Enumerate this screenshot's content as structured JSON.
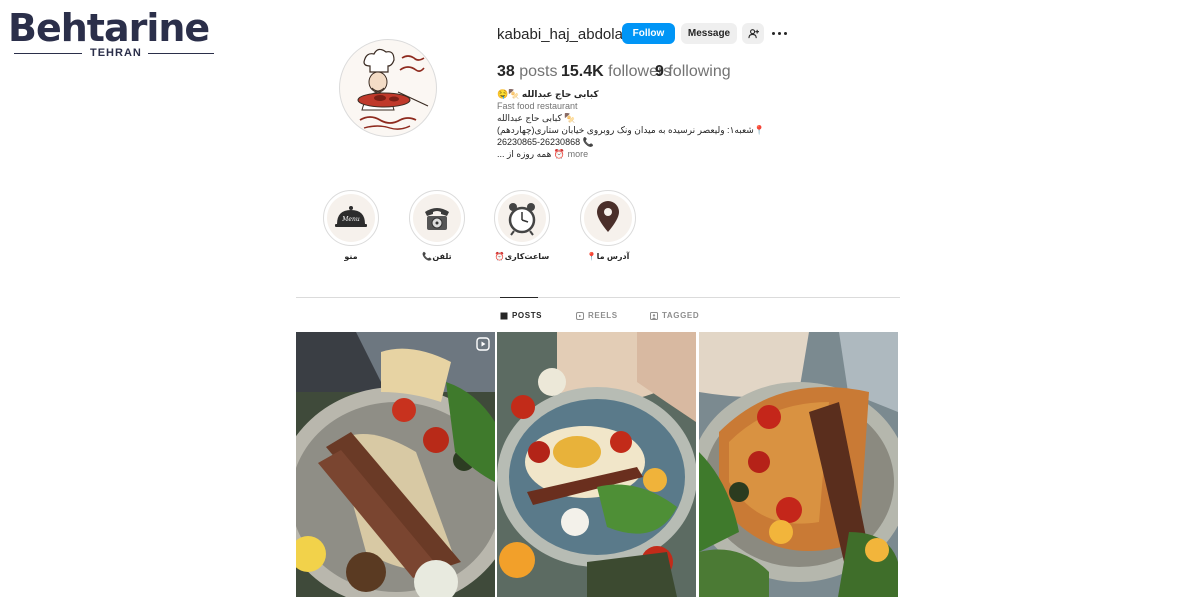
{
  "watermark": {
    "brand": "Behtarine",
    "city": "TEHRAN",
    "colors": {
      "text": "#2b2f4a",
      "accent": "#e0304a"
    }
  },
  "profile": {
    "username": "kababi_haj_abdolah",
    "follow_label": "Follow",
    "message_label": "Message",
    "adduser_icon": "add-user-icon",
    "more_icon": "more-options-icon",
    "avatar_icon": "restaurant-logo-chef",
    "avatar_caption_lines": [
      "باقرن",
      "سابقه",
      "کبابی حاج عبدالله"
    ]
  },
  "stats": {
    "posts": {
      "count": "38",
      "label": "posts"
    },
    "followers": {
      "count": "15.4K",
      "label": "followers"
    },
    "following": {
      "count": "9",
      "label": "following"
    }
  },
  "bio": {
    "name": "کبابی حاج عبدالله 🍢🤤",
    "category": "Fast food restaurant",
    "lines": [
      "🍢 کبابی حاج عبدالله",
      "📍شعبه۱: ولیعصر نرسیده به میدان ونک روبروی خیابان ستاری(چهاردهم)",
      "📞 26230865-26230868"
    ],
    "last_line": "⏰ همه روزه از ...",
    "more_label": "more"
  },
  "highlights": [
    {
      "label": "منو",
      "icon": "menu-cloche-icon"
    },
    {
      "label": "📞تلفن",
      "icon": "telephone-icon"
    },
    {
      "label": "⏰ساعت‌کاری",
      "icon": "alarm-clock-icon"
    },
    {
      "label": "📍آدرس ما",
      "icon": "location-pin-icon"
    }
  ],
  "tabs": [
    {
      "label": "POSTS",
      "icon": "grid-icon",
      "active": true
    },
    {
      "label": "REELS",
      "icon": "reels-icon",
      "active": false
    },
    {
      "label": "TAGGED",
      "icon": "tagged-icon",
      "active": false
    }
  ],
  "posts": [
    {
      "description": "koobideh kebab platter with bread and grilled tomatoes",
      "reel": true
    },
    {
      "description": "kebab with saffron rice, herbs and yogurt",
      "reel": false
    },
    {
      "description": "mixed kebab platter with grilled chicken and peppers",
      "reel": false
    }
  ],
  "colors": {
    "primary_blue": "#0095f6",
    "button_gray": "#efefef",
    "text_dark": "#262626",
    "text_muted": "#737373",
    "border": "#dbdbdb"
  }
}
